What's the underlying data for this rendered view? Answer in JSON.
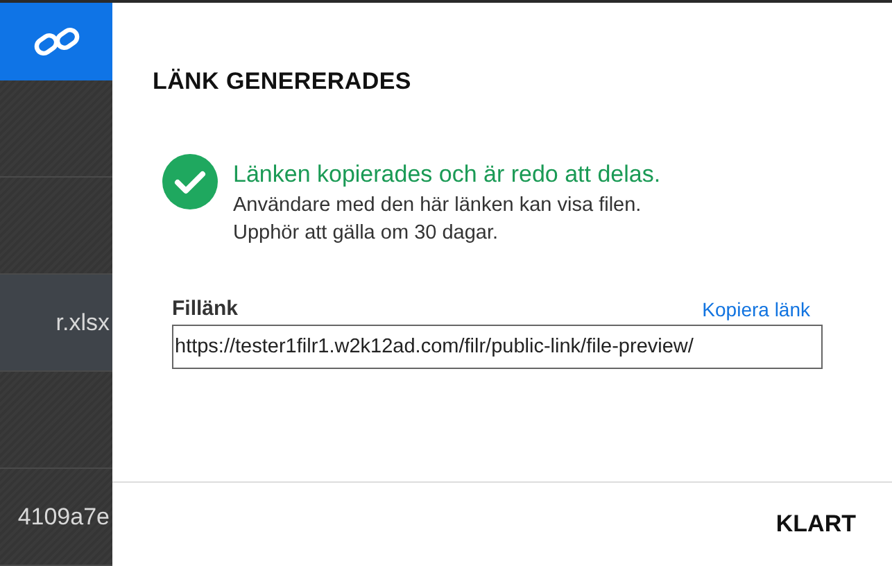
{
  "background_list": {
    "rows": [
      {
        "selected": false
      },
      {
        "selected": false
      },
      {
        "name": "r.xlsx",
        "selected": true
      },
      {
        "selected": false
      },
      {
        "name": "4109a7e",
        "selected": false
      }
    ]
  },
  "dialog": {
    "title": "LÄNK GENERERADES",
    "status": {
      "kind": "success",
      "headline": "Länken kopierades och är redo att delas.",
      "lines": [
        "Användare med den här länken kan visa filen.",
        "Upphör att gälla om 30 dagar."
      ]
    },
    "field": {
      "label": "Fillänk",
      "action": "Kopiera länk",
      "value": "https://tester1filr1.w2k12ad.com/filr/public-link/file-preview/"
    },
    "buttons": [
      "KLART"
    ]
  }
}
